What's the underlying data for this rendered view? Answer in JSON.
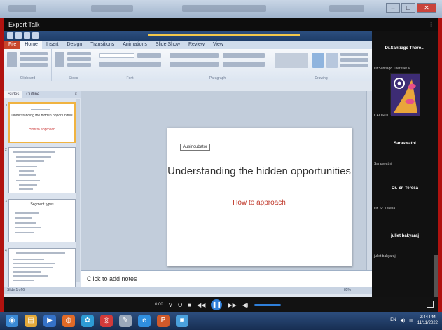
{
  "app": {
    "title": "Expert Talk",
    "menu_glyph": "⁝"
  },
  "window": {
    "controls": [
      "–",
      "□",
      "✕"
    ]
  },
  "powerpoint": {
    "tabs": [
      "File",
      "Home",
      "Insert",
      "Design",
      "Transitions",
      "Animations",
      "Slide Show",
      "Review",
      "View"
    ],
    "active_tab": "Home",
    "groups": [
      "Clipboard",
      "Slides",
      "Font",
      "Paragraph",
      "Drawing"
    ],
    "pane_tabs": [
      "Slides",
      "Outline"
    ],
    "pane_close": "×",
    "thumbnails": [
      {
        "num": "1",
        "title": "Understanding the hidden opportunities",
        "subtitle": "How to approach"
      },
      {
        "num": "2",
        "title": "",
        "subtitle": ""
      },
      {
        "num": "3",
        "title": "Segment types",
        "subtitle": ""
      },
      {
        "num": "4",
        "title": "",
        "subtitle": ""
      }
    ],
    "slide": {
      "textbox_label": "Ausincubator",
      "title": "Understanding the hidden opportunities",
      "subtitle": "How to approach"
    },
    "notes_placeholder": "Click to add notes",
    "status_left": "Slide 1 of 6",
    "status_right": "85%"
  },
  "participants": [
    {
      "name": "Dr.Santiago Thero...",
      "subtitle": "Dr.Santiago Therese! V",
      "extra": "CEO PTD",
      "has_avatar": true
    },
    {
      "name": "Saraswathi",
      "subtitle": "Saraswathi",
      "has_avatar": false
    },
    {
      "name": "Dr. Sr. Teresa",
      "subtitle": "Dr. Sr. Teresa",
      "has_avatar": false
    },
    {
      "name": "juliet bakyaraj",
      "subtitle": "juliet bakyaraj",
      "has_avatar": false
    }
  ],
  "player": {
    "time": "0:00",
    "buttons": [
      "V",
      "O",
      "■",
      "◀◀",
      "❚❚",
      "▶▶",
      "◀)"
    ]
  },
  "taskbar": {
    "icons": [
      {
        "name": "chrome-icon",
        "glyph": "◉",
        "color": "#3a8ad6"
      },
      {
        "name": "explorer-icon",
        "glyph": "▤",
        "color": "#e3a93a"
      },
      {
        "name": "media-player-icon",
        "glyph": "▶",
        "color": "#3572c8"
      },
      {
        "name": "firefox-icon",
        "glyph": "◍",
        "color": "#e06a27"
      },
      {
        "name": "app-icon",
        "glyph": "✿",
        "color": "#2d9bd4"
      },
      {
        "name": "opera-icon",
        "glyph": "◎",
        "color": "#d23a3a"
      },
      {
        "name": "pen-icon",
        "glyph": "✎",
        "color": "#9aa8bb"
      },
      {
        "name": "ie-icon",
        "glyph": "e",
        "color": "#2f8fe0"
      },
      {
        "name": "powerpoint-icon",
        "glyph": "P",
        "color": "#d0592a"
      },
      {
        "name": "camera-icon",
        "glyph": "◙",
        "color": "#4aa0dc"
      }
    ],
    "lang": "EN",
    "time": "2:44 PM",
    "date": "11/11/2022"
  }
}
